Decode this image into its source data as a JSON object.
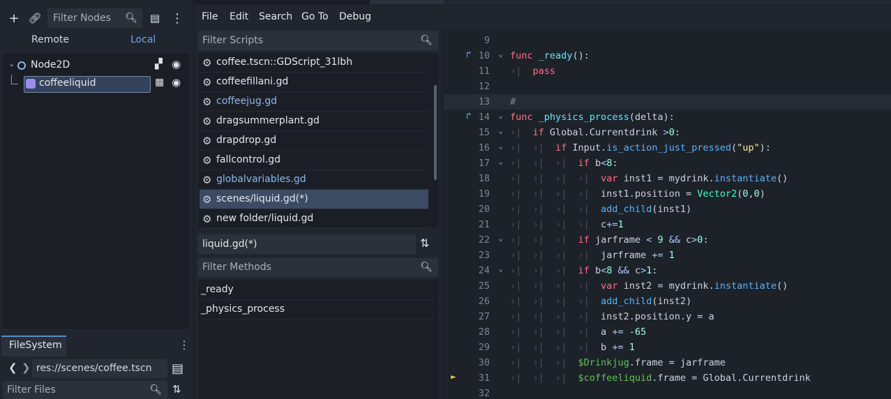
{
  "scene_dock": {
    "filter_placeholder": "Filter Nodes",
    "remote_label": "Remote",
    "local_label": "Local",
    "tree": [
      {
        "name": "Node2D"
      },
      {
        "name": "coffeeliquid"
      }
    ]
  },
  "filesystem": {
    "tab_label": "FileSystem",
    "path": "res://scenes/coffee.tscn",
    "filter_placeholder": "Filter Files"
  },
  "menu": {
    "file": "File",
    "edit": "Edit",
    "search": "Search",
    "goto": "Go To",
    "debug": "Debug"
  },
  "scripts": {
    "filter_placeholder": "Filter Scripts",
    "items": [
      {
        "name": "coffee.tscn::GDScript_31lbh",
        "style": "normal"
      },
      {
        "name": "coffeefillani.gd",
        "style": "normal"
      },
      {
        "name": "coffeejug.gd",
        "style": "blue"
      },
      {
        "name": "dragsummerplant.gd",
        "style": "normal"
      },
      {
        "name": "drapdrop.gd",
        "style": "normal"
      },
      {
        "name": "fallcontrol.gd",
        "style": "normal"
      },
      {
        "name": "globalvariables.gd",
        "style": "blue"
      },
      {
        "name": "scenes/liquid.gd(*)",
        "style": "selected"
      },
      {
        "name": "new folder/liquid.gd",
        "style": "normal"
      }
    ],
    "current": "liquid.gd(*)"
  },
  "methods": {
    "filter_placeholder": "Filter Methods",
    "items": [
      "_ready",
      "_physics_process"
    ]
  },
  "editor": {
    "lines": [
      {
        "n": "9"
      },
      {
        "n": "10"
      },
      {
        "n": "11"
      },
      {
        "n": "12"
      },
      {
        "n": "13"
      },
      {
        "n": "14"
      },
      {
        "n": "15"
      },
      {
        "n": "16"
      },
      {
        "n": "17"
      },
      {
        "n": "18"
      },
      {
        "n": "19"
      },
      {
        "n": "20"
      },
      {
        "n": "21"
      },
      {
        "n": "22"
      },
      {
        "n": "23"
      },
      {
        "n": "24"
      },
      {
        "n": "25"
      },
      {
        "n": "26"
      },
      {
        "n": "27"
      },
      {
        "n": "28"
      },
      {
        "n": "29"
      },
      {
        "n": "30"
      },
      {
        "n": "31"
      },
      {
        "n": "32"
      }
    ],
    "code": {
      "l10a": "func",
      "l10b": "_ready",
      "l10c": "():",
      "l11": "pass",
      "l13": "#",
      "l14a": "func",
      "l14b": "_physics_process",
      "l14c": "(delta):",
      "l15a": "if",
      "l15b": " Global.Currentdrink ",
      "l15c": ">",
      "l15d": "0",
      "l15e": ":",
      "l16a": "if",
      "l16b": " Input.",
      "l16c": "is_action_just_pressed",
      "l16d": "(",
      "l16e": "\"up\"",
      "l16f": "):",
      "l17a": "if",
      "l17b": " b",
      "l17c": "<",
      "l17d": "8",
      "l17e": ":",
      "l18a": "var",
      "l18b": " inst1 = mydrink.",
      "l18c": "instantiate",
      "l18d": "()",
      "l19a": "inst1.position = ",
      "l19b": "Vector2",
      "l19c": "(",
      "l19d": "0",
      "l19e": ",",
      "l19f": "0",
      "l19g": ")",
      "l20a": "add_child",
      "l20b": "(inst1)",
      "l21a": "c",
      "l21b": "+=",
      "l21c": "1",
      "l22a": "if",
      "l22b": " jarframe ",
      "l22c": "<",
      "l22d": " 9 ",
      "l22e": "&&",
      "l22f": " c",
      "l22g": ">",
      "l22h": "0",
      "l22i": ":",
      "l23a": "jarframe ",
      "l23b": "+=",
      "l23c": " 1",
      "l24a": "if",
      "l24b": " b",
      "l24c": "<",
      "l24d": "8",
      "l24e": " && ",
      "l24f": "c",
      "l24g": ">",
      "l24h": "1",
      "l24i": ":",
      "l25a": "var",
      "l25b": " inst2 = mydrink.",
      "l25c": "instantiate",
      "l25d": "()",
      "l26a": "add_child",
      "l26b": "(inst2)",
      "l27": "inst2.position.y = a",
      "l28a": "a ",
      "l28b": "+=",
      "l28c": " -65",
      "l29a": "b ",
      "l29b": "+=",
      "l29c": " 1",
      "l30a": "$Drinkjug",
      "l30b": ".frame = jarframe",
      "l31a": "$coffeeliquid",
      "l31b": ".frame = Global.Currentdrink"
    }
  },
  "colors": {
    "accent": "#5a8bc8",
    "keyword": "#ff7085",
    "function": "#66e6ff",
    "number": "#a1ffe0",
    "string": "#ffeda1",
    "node_path": "#63c259"
  }
}
